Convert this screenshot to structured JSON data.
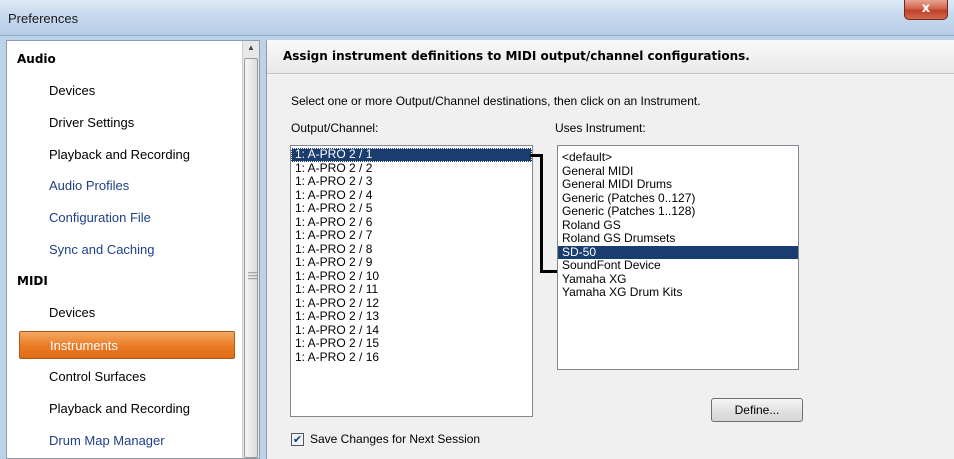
{
  "window": {
    "title": "Preferences",
    "close_glyph": "x"
  },
  "tree": {
    "items": [
      {
        "label": "Audio",
        "type": "group"
      },
      {
        "label": "Devices",
        "type": "child"
      },
      {
        "label": "Driver Settings",
        "type": "child"
      },
      {
        "label": "Playback and Recording",
        "type": "child"
      },
      {
        "label": "Audio Profiles",
        "type": "link"
      },
      {
        "label": "Configuration File",
        "type": "link"
      },
      {
        "label": "Sync and Caching",
        "type": "link"
      },
      {
        "label": "MIDI",
        "type": "group"
      },
      {
        "label": "Devices",
        "type": "child"
      },
      {
        "label": "Instruments",
        "type": "selected"
      },
      {
        "label": "Control Surfaces",
        "type": "child"
      },
      {
        "label": "Playback and Recording",
        "type": "child"
      },
      {
        "label": "Drum Map Manager",
        "type": "link"
      }
    ]
  },
  "main": {
    "header": "Assign instrument definitions to MIDI output/channel configurations.",
    "instructions": "Select one or more Output/Channel destinations, then click on an Instrument.",
    "output_label": "Output/Channel:",
    "instrument_label": "Uses Instrument:",
    "outputs": [
      "1: A-PRO 2 / 1",
      "1: A-PRO 2 / 2",
      "1: A-PRO 2 / 3",
      "1: A-PRO 2 / 4",
      "1: A-PRO 2 / 5",
      "1: A-PRO 2 / 6",
      "1: A-PRO 2 / 7",
      "1: A-PRO 2 / 8",
      "1: A-PRO 2 / 9",
      "1: A-PRO 2 / 10",
      "1: A-PRO 2 / 11",
      "1: A-PRO 2 / 12",
      "1: A-PRO 2 / 13",
      "1: A-PRO 2 / 14",
      "1: A-PRO 2 / 15",
      "1: A-PRO 2 / 16"
    ],
    "selected_output": 0,
    "instruments": [
      "<default>",
      "General MIDI",
      "General MIDI Drums",
      "Generic (Patches 0..127)",
      "Generic (Patches 1..128)",
      "Roland GS",
      "Roland GS Drumsets",
      "SD-50",
      "SoundFont Device",
      "Yamaha XG",
      "Yamaha XG Drum Kits"
    ],
    "selected_instrument": 7,
    "define_button": "Define...",
    "save_changes_label": "Save Changes for Next Session",
    "save_changes_checked": true
  }
}
